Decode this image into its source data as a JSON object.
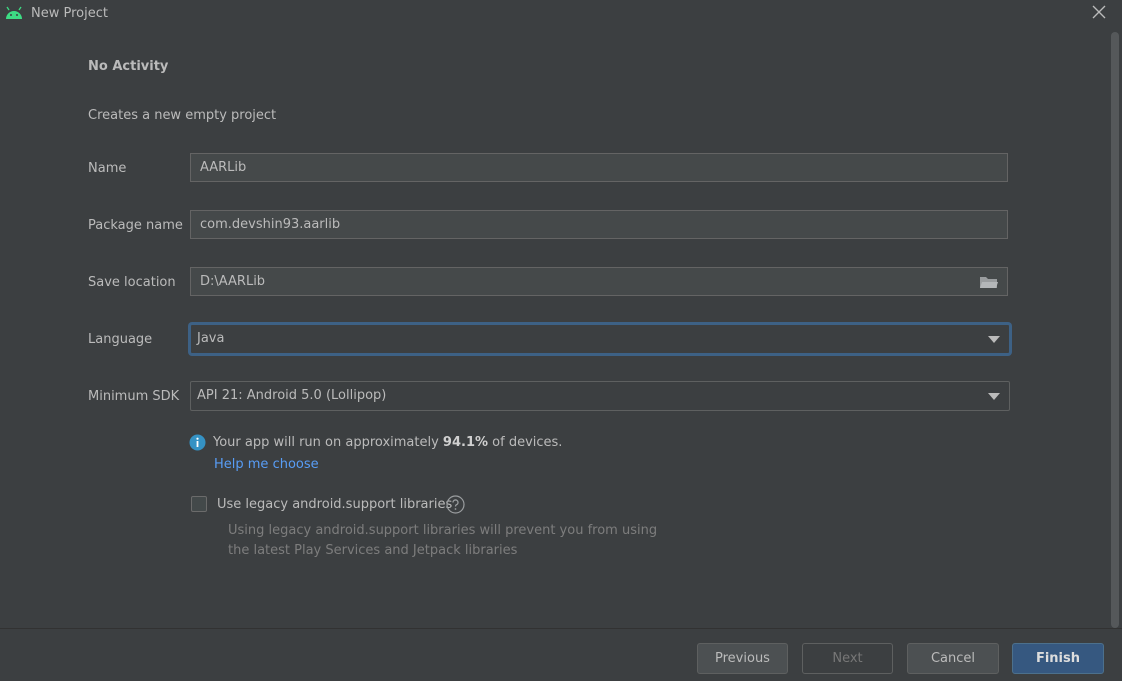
{
  "window": {
    "title": "New Project",
    "accent": "#3d6185",
    "link_color": "#589df6"
  },
  "header": {
    "heading": "No Activity",
    "description": "Creates a new empty project"
  },
  "form": {
    "name": {
      "label": "Name",
      "value": "AARLib"
    },
    "package": {
      "label": "Package name",
      "value": "com.devshin93.aarlib"
    },
    "location": {
      "label": "Save location",
      "value": "D:\\AARLib"
    },
    "language": {
      "label": "Language",
      "value": "Java"
    },
    "min_sdk": {
      "label": "Minimum SDK",
      "value": "API 21: Android 5.0 (Lollipop)"
    }
  },
  "info": {
    "prefix": "Your app will run on approximately ",
    "percent": "94.1%",
    "suffix": " of devices.",
    "help_link": "Help me choose"
  },
  "legacy": {
    "label": "Use legacy android.support libraries",
    "checked": false,
    "hint_line1": "Using legacy android.support libraries will prevent you from using",
    "hint_line2": "the latest Play Services and Jetpack libraries"
  },
  "buttons": {
    "previous": "Previous",
    "next": "Next",
    "cancel": "Cancel",
    "finish": "Finish"
  }
}
